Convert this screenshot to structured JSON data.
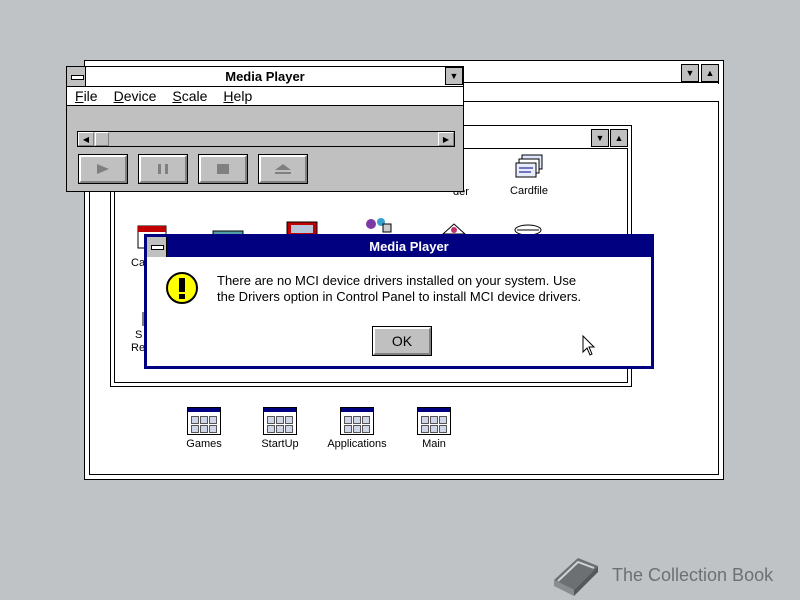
{
  "media_player": {
    "title": "Media Player",
    "menu": [
      {
        "letter": "F",
        "rest": "ile"
      },
      {
        "letter": "D",
        "rest": "evice"
      },
      {
        "letter": "S",
        "rest": "cale"
      },
      {
        "letter": "H",
        "rest": "elp"
      }
    ],
    "controls": [
      "play-icon",
      "pause-icon",
      "stop-icon",
      "eject-icon"
    ]
  },
  "accessories": {
    "visible_labels": [
      "Cardfile",
      "der",
      "Ca",
      "S",
      "Re"
    ]
  },
  "program_groups": [
    "Games",
    "StartUp",
    "Applications",
    "Main"
  ],
  "message_box": {
    "title": "Media Player",
    "line1": "There are no MCI device drivers installed on your system.  Use",
    "line2": "the Drivers option in Control Panel to install MCI device drivers.",
    "ok_label": "OK",
    "icon": "exclamation-icon"
  },
  "watermark": {
    "text": "The Collection Book"
  },
  "colors": {
    "desktop": "#c0c3c6",
    "active_title": "#000080",
    "exclamation_fill": "#ffff00"
  }
}
